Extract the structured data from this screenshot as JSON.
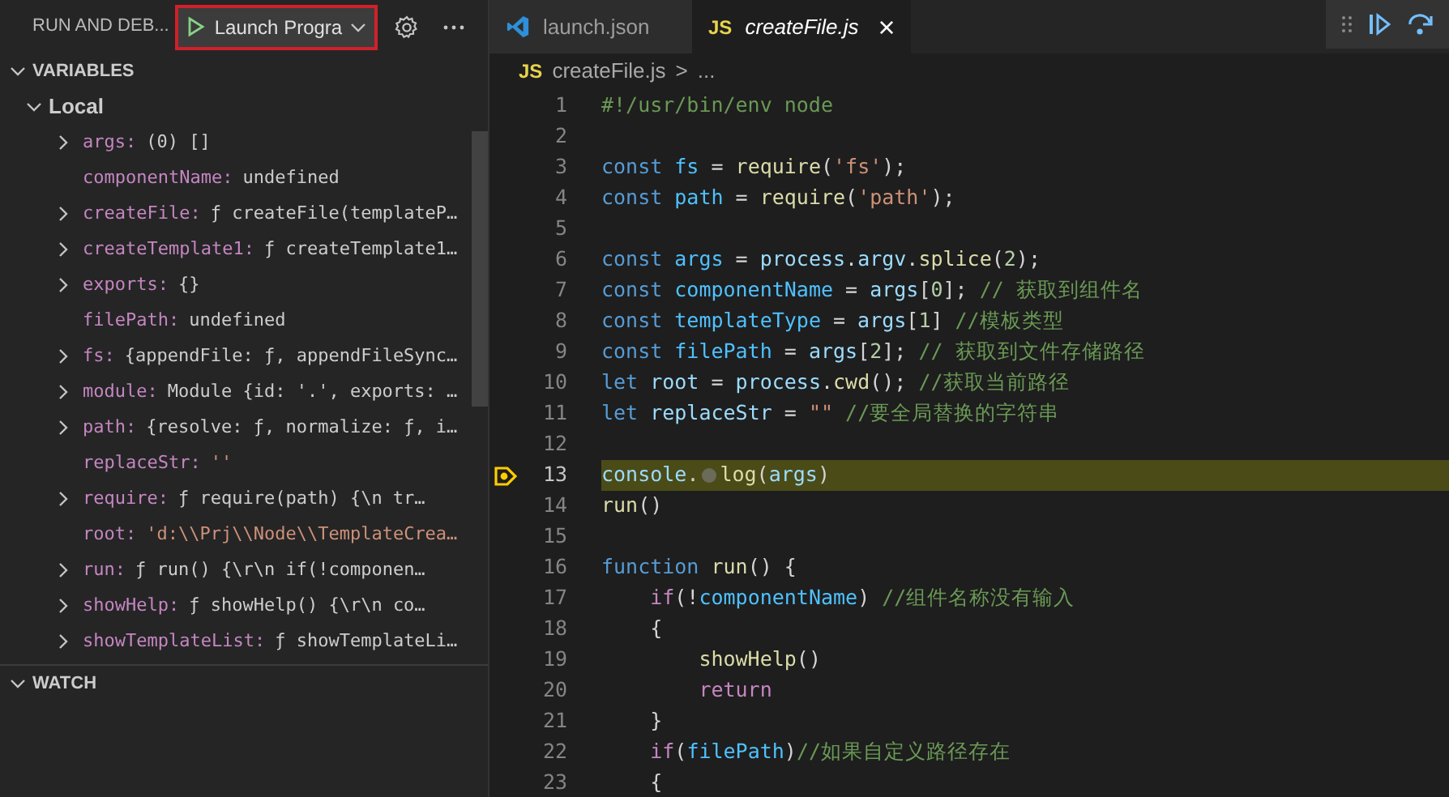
{
  "sidebar": {
    "title": "RUN AND DEB...",
    "launch_config": "Launch Progra",
    "variables": {
      "title": "VARIABLES",
      "expanded": true,
      "scope": {
        "title": "Local",
        "expanded": true,
        "items": [
          {
            "name": "args:",
            "value": "(0) []",
            "expandable": true,
            "kind": "plain"
          },
          {
            "name": "componentName:",
            "value": "undefined",
            "expandable": false,
            "kind": "plain"
          },
          {
            "name": "createFile:",
            "value": "ƒ createFile(templateP…",
            "expandable": true,
            "kind": "plain"
          },
          {
            "name": "createTemplate1:",
            "value": "ƒ createTemplate1…",
            "expandable": true,
            "kind": "plain"
          },
          {
            "name": "exports:",
            "value": "{}",
            "expandable": true,
            "kind": "plain"
          },
          {
            "name": "filePath:",
            "value": "undefined",
            "expandable": false,
            "kind": "plain"
          },
          {
            "name": "fs:",
            "value": "{appendFile: ƒ, appendFileSync…",
            "expandable": true,
            "kind": "plain"
          },
          {
            "name": "module:",
            "value": "Module {id: '.', exports: …",
            "expandable": true,
            "kind": "plain"
          },
          {
            "name": "path:",
            "value": "{resolve: ƒ, normalize: ƒ, i…",
            "expandable": true,
            "kind": "plain"
          },
          {
            "name": "replaceStr:",
            "value": "''",
            "expandable": false,
            "kind": "string"
          },
          {
            "name": "require:",
            "value": "ƒ require(path) {\\n    tr…",
            "expandable": true,
            "kind": "plain"
          },
          {
            "name": "root:",
            "value": "'d:\\\\Prj\\\\Node\\\\TemplateCrea…",
            "expandable": false,
            "kind": "string"
          },
          {
            "name": "run:",
            "value": "ƒ run() {\\r\\n    if(!componen…",
            "expandable": true,
            "kind": "plain"
          },
          {
            "name": "showHelp:",
            "value": "ƒ showHelp() {\\r\\n    co…",
            "expandable": true,
            "kind": "plain"
          },
          {
            "name": "showTemplateList:",
            "value": "ƒ showTemplateLi…",
            "expandable": true,
            "kind": "plain"
          }
        ]
      }
    },
    "watch": {
      "title": "WATCH",
      "expanded": true
    }
  },
  "tabs": [
    {
      "label": "launch.json",
      "kind": "json",
      "selected": false
    },
    {
      "label": "createFile.js",
      "kind": "js",
      "selected": true
    }
  ],
  "breadcrumb": {
    "file_badge": "JS",
    "file": "createFile.js",
    "separator": ">",
    "rest": "..."
  },
  "tab_badge": "JS",
  "close_glyph": "×",
  "code": [
    {
      "number": "1",
      "current": false,
      "tokens": [
        {
          "text": "#!/usr/bin/env node",
          "kind": "comment"
        }
      ]
    },
    {
      "number": "2",
      "current": false
    },
    {
      "number": "3",
      "current": false,
      "tokens": [
        {
          "text": "const ",
          "kind": "keyword"
        },
        {
          "text": "fs",
          "kind": "const"
        },
        {
          "text": " = ",
          "kind": "plain"
        },
        {
          "text": "require",
          "kind": "func"
        },
        {
          "text": "(",
          "kind": "plain"
        },
        {
          "text": "'fs'",
          "kind": "string"
        },
        {
          "text": ");",
          "kind": "plain"
        }
      ]
    },
    {
      "number": "4",
      "current": false,
      "tokens": [
        {
          "text": "const ",
          "kind": "keyword"
        },
        {
          "text": "path",
          "kind": "const"
        },
        {
          "text": " = ",
          "kind": "plain"
        },
        {
          "text": "require",
          "kind": "func"
        },
        {
          "text": "(",
          "kind": "plain"
        },
        {
          "text": "'path'",
          "kind": "string"
        },
        {
          "text": ");",
          "kind": "plain"
        }
      ]
    },
    {
      "number": "5",
      "current": false
    },
    {
      "number": "6",
      "current": false,
      "tokens": [
        {
          "text": "const ",
          "kind": "keyword"
        },
        {
          "text": "args",
          "kind": "const"
        },
        {
          "text": " = ",
          "kind": "plain"
        },
        {
          "text": "process",
          "kind": "var"
        },
        {
          "text": ".",
          "kind": "plain"
        },
        {
          "text": "argv",
          "kind": "var"
        },
        {
          "text": ".",
          "kind": "plain"
        },
        {
          "text": "splice",
          "kind": "func"
        },
        {
          "text": "(",
          "kind": "plain"
        },
        {
          "text": "2",
          "kind": "number"
        },
        {
          "text": ");",
          "kind": "plain"
        }
      ]
    },
    {
      "number": "7",
      "current": false,
      "tokens": [
        {
          "text": "const ",
          "kind": "keyword"
        },
        {
          "text": "componentName",
          "kind": "const"
        },
        {
          "text": " = ",
          "kind": "plain"
        },
        {
          "text": "args",
          "kind": "var"
        },
        {
          "text": "[",
          "kind": "plain"
        },
        {
          "text": "0",
          "kind": "number"
        },
        {
          "text": "]; ",
          "kind": "plain"
        },
        {
          "text": "// 获取到组件名",
          "kind": "comment"
        }
      ]
    },
    {
      "number": "8",
      "current": false,
      "tokens": [
        {
          "text": "const ",
          "kind": "keyword"
        },
        {
          "text": "templateType",
          "kind": "const"
        },
        {
          "text": " = ",
          "kind": "plain"
        },
        {
          "text": "args",
          "kind": "var"
        },
        {
          "text": "[",
          "kind": "plain"
        },
        {
          "text": "1",
          "kind": "number"
        },
        {
          "text": "] ",
          "kind": "plain"
        },
        {
          "text": "//模板类型",
          "kind": "comment"
        }
      ]
    },
    {
      "number": "9",
      "current": false,
      "tokens": [
        {
          "text": "const ",
          "kind": "keyword"
        },
        {
          "text": "filePath",
          "kind": "const"
        },
        {
          "text": " = ",
          "kind": "plain"
        },
        {
          "text": "args",
          "kind": "var"
        },
        {
          "text": "[",
          "kind": "plain"
        },
        {
          "text": "2",
          "kind": "number"
        },
        {
          "text": "]; ",
          "kind": "plain"
        },
        {
          "text": "// 获取到文件存储路径",
          "kind": "comment"
        }
      ]
    },
    {
      "number": "10",
      "current": false,
      "tokens": [
        {
          "text": "let ",
          "kind": "keyword"
        },
        {
          "text": "root",
          "kind": "var"
        },
        {
          "text": " = ",
          "kind": "plain"
        },
        {
          "text": "process",
          "kind": "var"
        },
        {
          "text": ".",
          "kind": "plain"
        },
        {
          "text": "cwd",
          "kind": "func"
        },
        {
          "text": "(); ",
          "kind": "plain"
        },
        {
          "text": "//获取当前路径",
          "kind": "comment"
        }
      ]
    },
    {
      "number": "11",
      "current": false,
      "tokens": [
        {
          "text": "let ",
          "kind": "keyword"
        },
        {
          "text": "replaceStr",
          "kind": "var"
        },
        {
          "text": " = ",
          "kind": "plain"
        },
        {
          "text": "\"\"",
          "kind": "string"
        },
        {
          "text": " //要全局替换的字符串",
          "kind": "comment"
        }
      ]
    },
    {
      "number": "12",
      "current": false
    },
    {
      "number": "13",
      "current": true,
      "tokens": [
        {
          "text": "console",
          "kind": "var"
        },
        {
          "text": ".",
          "kind": "plain"
        },
        {
          "kind": "inline_breakpoint"
        },
        {
          "text": "log",
          "kind": "func"
        },
        {
          "text": "(",
          "kind": "plain"
        },
        {
          "text": "args",
          "kind": "var"
        },
        {
          "text": ")",
          "kind": "plain"
        }
      ]
    },
    {
      "number": "14",
      "current": false,
      "tokens": [
        {
          "text": "run",
          "kind": "func"
        },
        {
          "text": "()",
          "kind": "plain"
        }
      ]
    },
    {
      "number": "15",
      "current": false
    },
    {
      "number": "16",
      "current": false,
      "tokens": [
        {
          "text": "function ",
          "kind": "keyword"
        },
        {
          "text": "run",
          "kind": "func"
        },
        {
          "text": "() {",
          "kind": "plain"
        }
      ]
    },
    {
      "number": "17",
      "current": false,
      "tokens": [
        {
          "text": "    if",
          "kind": "control"
        },
        {
          "text": "(!",
          "kind": "plain"
        },
        {
          "text": "componentName",
          "kind": "const"
        },
        {
          "text": ") ",
          "kind": "plain"
        },
        {
          "text": "//组件名称没有输入",
          "kind": "comment"
        }
      ]
    },
    {
      "number": "18",
      "current": false,
      "tokens": [
        {
          "text": "    {",
          "kind": "plain"
        }
      ]
    },
    {
      "number": "19",
      "current": false,
      "tokens": [
        {
          "text": "        showHelp",
          "kind": "func"
        },
        {
          "text": "()",
          "kind": "plain"
        }
      ]
    },
    {
      "number": "20",
      "current": false,
      "tokens": [
        {
          "text": "        return",
          "kind": "control"
        }
      ]
    },
    {
      "number": "21",
      "current": false,
      "tokens": [
        {
          "text": "    }",
          "kind": "plain"
        }
      ]
    },
    {
      "number": "22",
      "current": false,
      "tokens": [
        {
          "text": "    if",
          "kind": "control"
        },
        {
          "text": "(",
          "kind": "plain"
        },
        {
          "text": "filePath",
          "kind": "const"
        },
        {
          "text": ")",
          "kind": "plain"
        },
        {
          "text": "//如果自定义路径存在",
          "kind": "comment"
        }
      ]
    },
    {
      "number": "23",
      "current": false,
      "tokens": [
        {
          "text": "    {",
          "kind": "plain"
        }
      ]
    }
  ]
}
